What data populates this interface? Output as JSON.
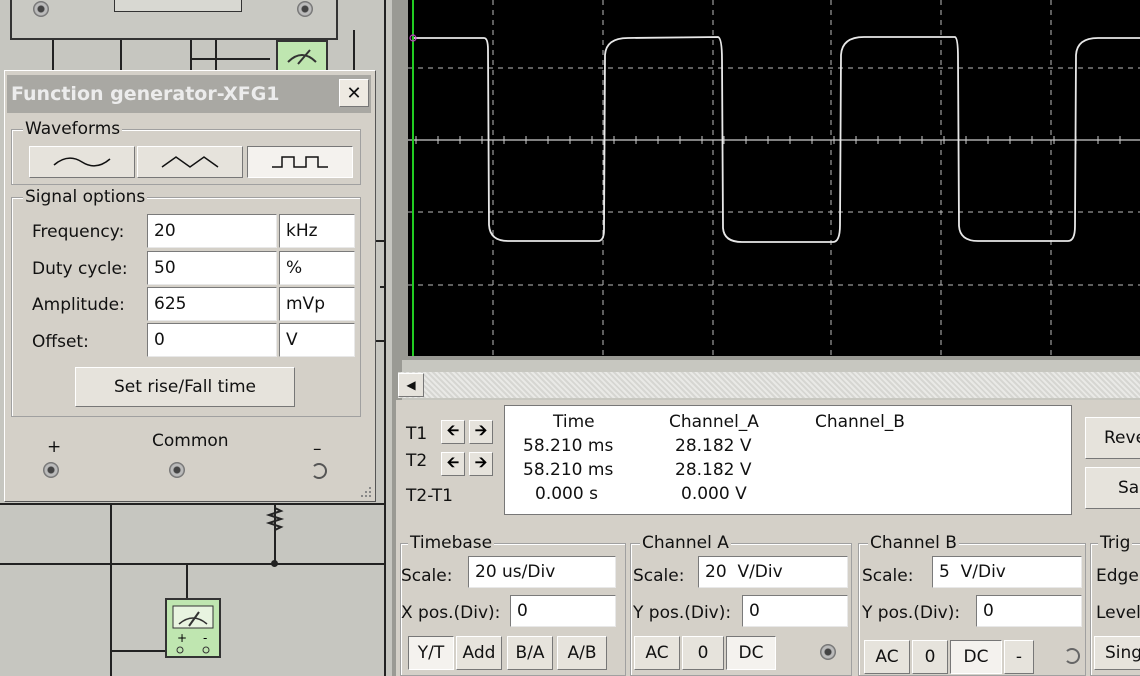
{
  "function_generator": {
    "title": "Function generator-XFG1",
    "close_label": "✕",
    "waveforms_label": "Waveforms",
    "signal_options_label": "Signal options",
    "frequency": {
      "label": "Frequency:",
      "value": "20",
      "unit": "kHz"
    },
    "duty_cycle": {
      "label": "Duty cycle:",
      "value": "50",
      "unit": "%"
    },
    "amplitude": {
      "label": "Amplitude:",
      "value": "625",
      "unit": "mVp"
    },
    "offset": {
      "label": "Offset:",
      "value": "0",
      "unit": "V"
    },
    "rise_fall_button": "Set rise/Fall time",
    "terminals": {
      "plus": "+",
      "common": "Common",
      "minus": "–"
    },
    "selected_waveform": "square"
  },
  "oscilloscope": {
    "readout": {
      "headers": {
        "time": "Time",
        "channel_a": "Channel_A",
        "channel_b": "Channel_B"
      },
      "rows": [
        {
          "label": "T1",
          "time": "58.210 ms",
          "channel_a": "28.182 V",
          "channel_b": ""
        },
        {
          "label": "T2",
          "time": "58.210 ms",
          "channel_a": "28.182 V",
          "channel_b": ""
        },
        {
          "label": "T2-T1",
          "time": "0.000 s",
          "channel_a": "0.000 V",
          "channel_b": ""
        }
      ]
    },
    "right_buttons": {
      "reverse": "Reve",
      "save": "Sa"
    },
    "timebase": {
      "title": "Timebase",
      "scale_label": "Scale:",
      "scale_value": "20 us/Div",
      "xpos_label": "X pos.(Div):",
      "xpos_value": "0",
      "modes": [
        "Y/T",
        "Add",
        "B/A",
        "A/B"
      ],
      "active_mode": "Y/T"
    },
    "channel_a": {
      "title": "Channel A",
      "scale_label": "Scale:",
      "scale_value": "20  V/Div",
      "ypos_label": "Y pos.(Div):",
      "ypos_value": "0",
      "coupling": [
        "AC",
        "0",
        "DC"
      ],
      "active_coupling": "DC"
    },
    "channel_b": {
      "title": "Channel B",
      "scale_label": "Scale:",
      "scale_value": "5  V/Div",
      "ypos_label": "Y pos.(Div):",
      "ypos_value": "0",
      "coupling": [
        "AC",
        "0",
        "DC",
        "-"
      ],
      "active_coupling": "DC"
    },
    "trigger": {
      "title": "Trig",
      "edge_label": "Edge",
      "level_label": "Level",
      "single_label": "Sing"
    }
  },
  "colors": {
    "trace": "#e8e8e8",
    "cursor": "#22cc22",
    "screen": "#000000",
    "grid": "#bbbbbb"
  }
}
